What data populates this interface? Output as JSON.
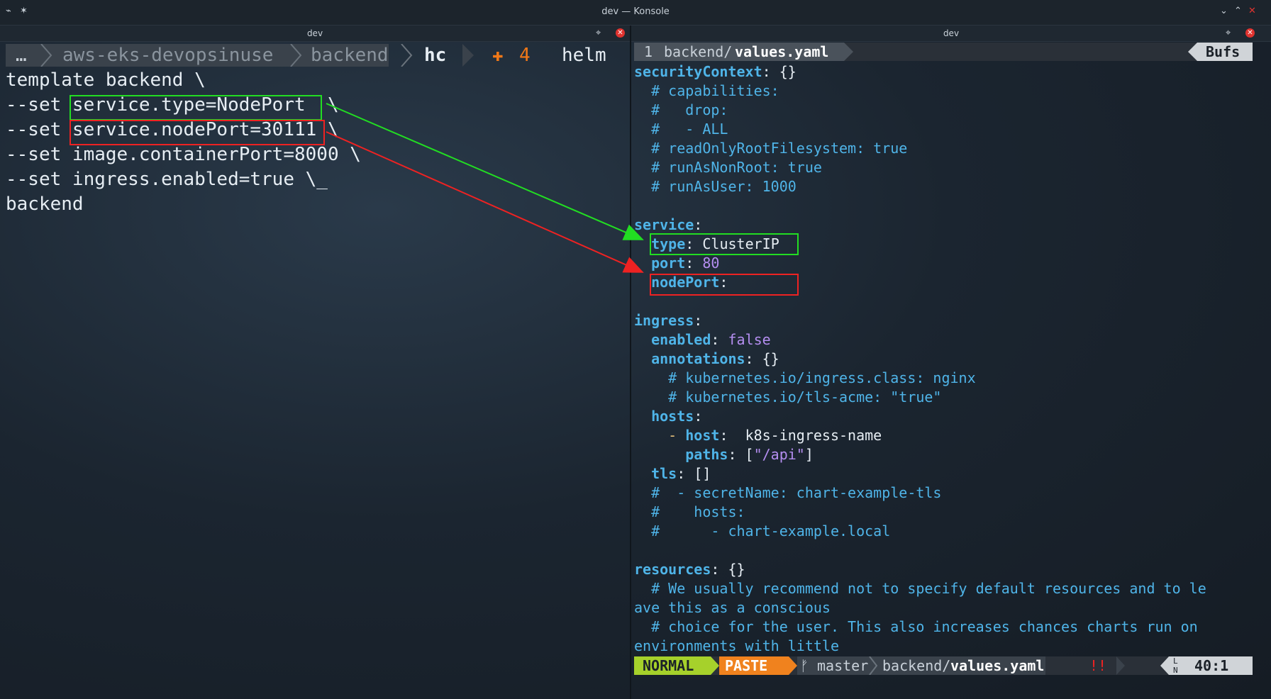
{
  "window": {
    "title": "dev — Konsole"
  },
  "left_pane": {
    "tab_label": "dev",
    "prompt": {
      "ellipsis": "…",
      "path": [
        "aws-eks-devopsinuse",
        "backend",
        "hc"
      ],
      "git_status_icon": "✚",
      "git_status_count": "4",
      "command": "helm"
    },
    "command_lines": [
      "template backend \\",
      "--set service.type=NodePort  \\",
      "--set service.nodePort=30111 \\",
      "--set image.containerPort=8000 \\",
      "--set ingress.enabled=true \\_",
      "backend"
    ]
  },
  "right_pane": {
    "tab_label": "dev",
    "buffer_tab": {
      "number": "1",
      "dir": "backend/",
      "file": "values.yaml",
      "bufs_label": "Bufs"
    },
    "code": {
      "l1": "securityContext",
      "l1v": "{}",
      "l2": "  # capabilities:",
      "l3": "  #   drop:",
      "l4": "  #   - ALL",
      "l5": "  # readOnlyRootFilesystem: true",
      "l6": "  # runAsNonRoot: true",
      "l7": "  # runAsUser: 1000",
      "l9": "service",
      "l10k": "type",
      "l10v": "ClusterIP",
      "l11k": "port",
      "l11v": "80",
      "l12k": "nodePort",
      "l14": "ingress",
      "l15k": "enabled",
      "l15v": "false",
      "l16k": "annotations",
      "l16v": "{}",
      "l17": "    # kubernetes.io/ingress.class: nginx",
      "l18": "    # kubernetes.io/tls-acme: \"true\"",
      "l19k": "hosts",
      "l20k": "host",
      "l20v": "k8s-ingress-name",
      "l21k": "paths",
      "l21v": "\"/api\"",
      "l22k": "tls",
      "l22v": "[]",
      "l23": "  #  - secretName: chart-example-tls",
      "l24": "  #    hosts:",
      "l25": "  #      - chart-example.local",
      "l27k": "resources",
      "l27v": "{}",
      "l28": "  # We usually recommend not to specify default resources and to le",
      "l29": "ave this as a conscious",
      "l30": "  # choice for the user. This also increases chances charts run on",
      "l31": "environments with little"
    },
    "statusline": {
      "mode": "NORMAL",
      "paste": "PASTE",
      "branch_icon": "ᚠ",
      "branch": "master",
      "file_dir": "backend/",
      "file_name": "values.yaml",
      "modified": "!!",
      "ln_label": "LN",
      "position": "40:1"
    }
  },
  "colors": {
    "green_box": "#22dd22",
    "red_box": "#ee2222",
    "key_blue": "#4fb4e8",
    "number_purple": "#b48ef0",
    "mode_green": "#a6d12b",
    "paste_orange": "#f0821e",
    "git_orange": "#f07818"
  }
}
